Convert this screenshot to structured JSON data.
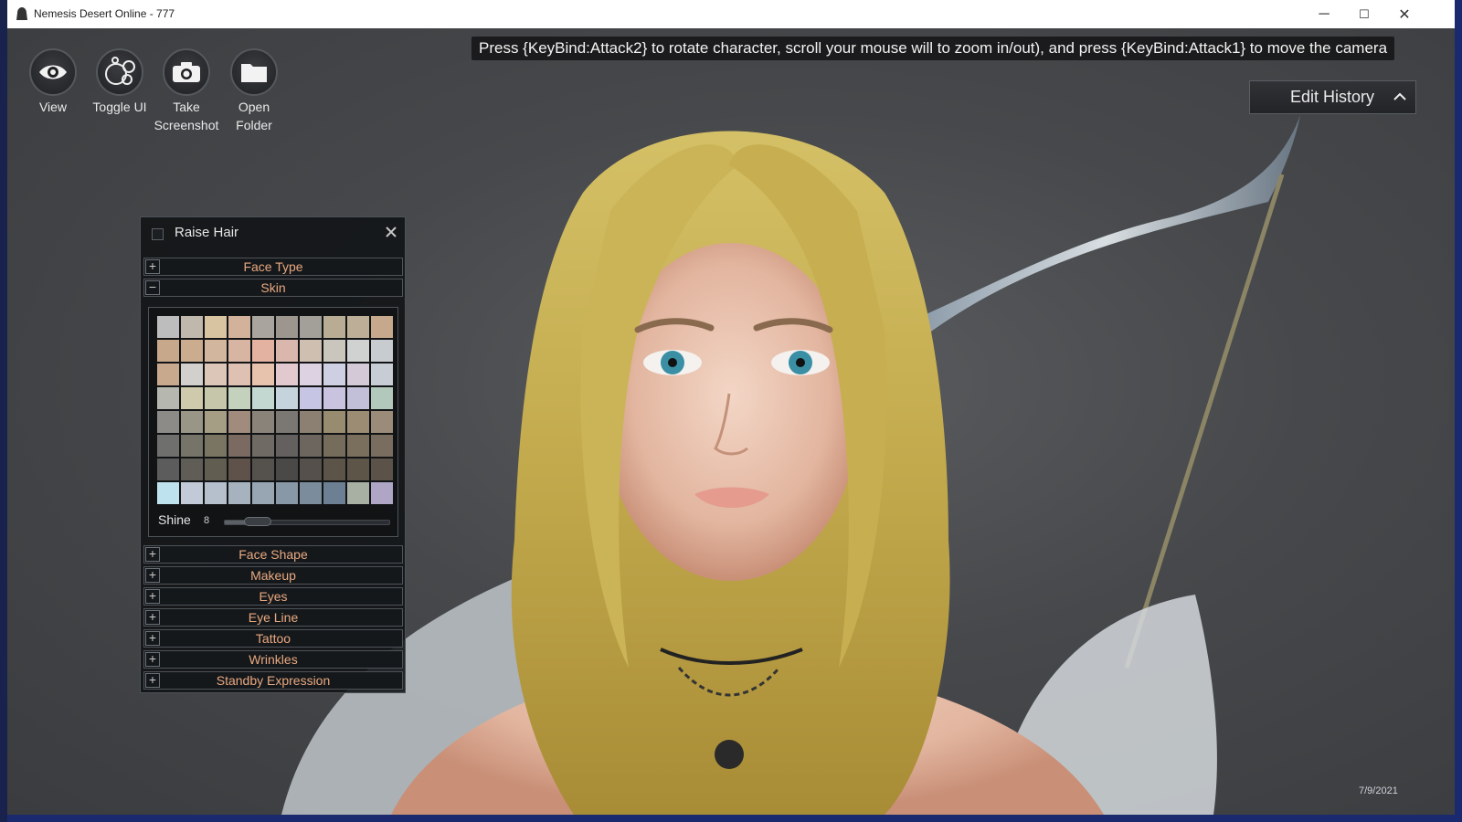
{
  "window": {
    "title": "Nemesis Desert Online - 777",
    "controls": {
      "minimize": "─",
      "maximize": "☐",
      "close": "✕"
    }
  },
  "hint": {
    "text": "Press {KeyBind:Attack2} to rotate character, scroll your mouse will to zoom in/out), and press {KeyBind:Attack1} to move the camera"
  },
  "toolbar": {
    "view": {
      "label": "View",
      "icon": "eye-icon"
    },
    "toggle_ui": {
      "label": "Toggle UI",
      "icon": "circles-icon"
    },
    "take_screenshot": {
      "label_line1": "Take",
      "label_line2": "Screenshot",
      "icon": "camera-icon"
    },
    "open_folder": {
      "label_line1": "Open",
      "label_line2": "Folder",
      "icon": "folder-icon"
    }
  },
  "edit_history": {
    "label": "Edit History",
    "icon": "chevron-up-icon"
  },
  "panel": {
    "title": "Raise Hair",
    "sections_top": [
      {
        "label": "Face Type",
        "state": "+"
      },
      {
        "label": "Skin",
        "state": "−"
      }
    ],
    "skin": {
      "shine_label": "Shine",
      "shine_value": "8",
      "shine_fraction": 0.2,
      "palette": [
        "#bdbdbd",
        "#c0b7ad",
        "#d8c4a0",
        "#d2b29b",
        "#a9a49d",
        "#9c968e",
        "#a39f99",
        "#b8ad94",
        "#bdae98",
        "#c6a98c",
        "#c8a88a",
        "#ccac8e",
        "#d2b79e",
        "#d8b4a2",
        "#e4b2a0",
        "#d9b7ad",
        "#cfbfb1",
        "#cbc6bd",
        "#cfd2d0",
        "#c8ccd0",
        "#c8a98e",
        "#d2cfcc",
        "#dcc6b8",
        "#dfc1b3",
        "#e7c2ad",
        "#e2c9d0",
        "#dcd2e2",
        "#cfcfe3",
        "#d4c9d7",
        "#c8ccd5",
        "#b6b8b0",
        "#cfcaab",
        "#c6c7aa",
        "#c4d2bd",
        "#c4d8d2",
        "#c4d3dc",
        "#c6c6e4",
        "#c9c3e0",
        "#c2c0d9",
        "#b3c8bd",
        "#8c8b88",
        "#9a9687",
        "#a59d84",
        "#a08b7c",
        "#8a8379",
        "#7b7773",
        "#8b8072",
        "#978b70",
        "#9b8c73",
        "#9a8c78",
        "#6f6f6e",
        "#767468",
        "#7a7563",
        "#7a6a61",
        "#6f6a63",
        "#646060",
        "#6d665e",
        "#766c5b",
        "#7a6e5d",
        "#796d5f",
        "#5c5c5c",
        "#5f5d56",
        "#615d50",
        "#5f524b",
        "#55514d",
        "#4b4948",
        "#55504b",
        "#5c5448",
        "#5e5549",
        "#5b5349",
        "#bfe3ee",
        "#c1cad6",
        "#b6c0cc",
        "#a6b2bd",
        "#97a6b2",
        "#8898a6",
        "#7b8c9c",
        "#6d8093",
        "#a8b0a3",
        "#aea6c4"
      ]
    },
    "sections_bottom": [
      {
        "label": "Face Shape",
        "state": "+"
      },
      {
        "label": "Makeup",
        "state": "+"
      },
      {
        "label": "Eyes",
        "state": "+"
      },
      {
        "label": "Eye Line",
        "state": "+"
      },
      {
        "label": "Tattoo",
        "state": "+"
      },
      {
        "label": "Wrinkles",
        "state": "+"
      },
      {
        "label": "Standby Expression",
        "state": "+"
      }
    ]
  },
  "taskbar_date": "7/9/2021",
  "colors": {
    "section_text": "#e8a880",
    "panel_bg": "#101214",
    "scene_bg": "#46484b",
    "hair": "#c8b04e"
  }
}
